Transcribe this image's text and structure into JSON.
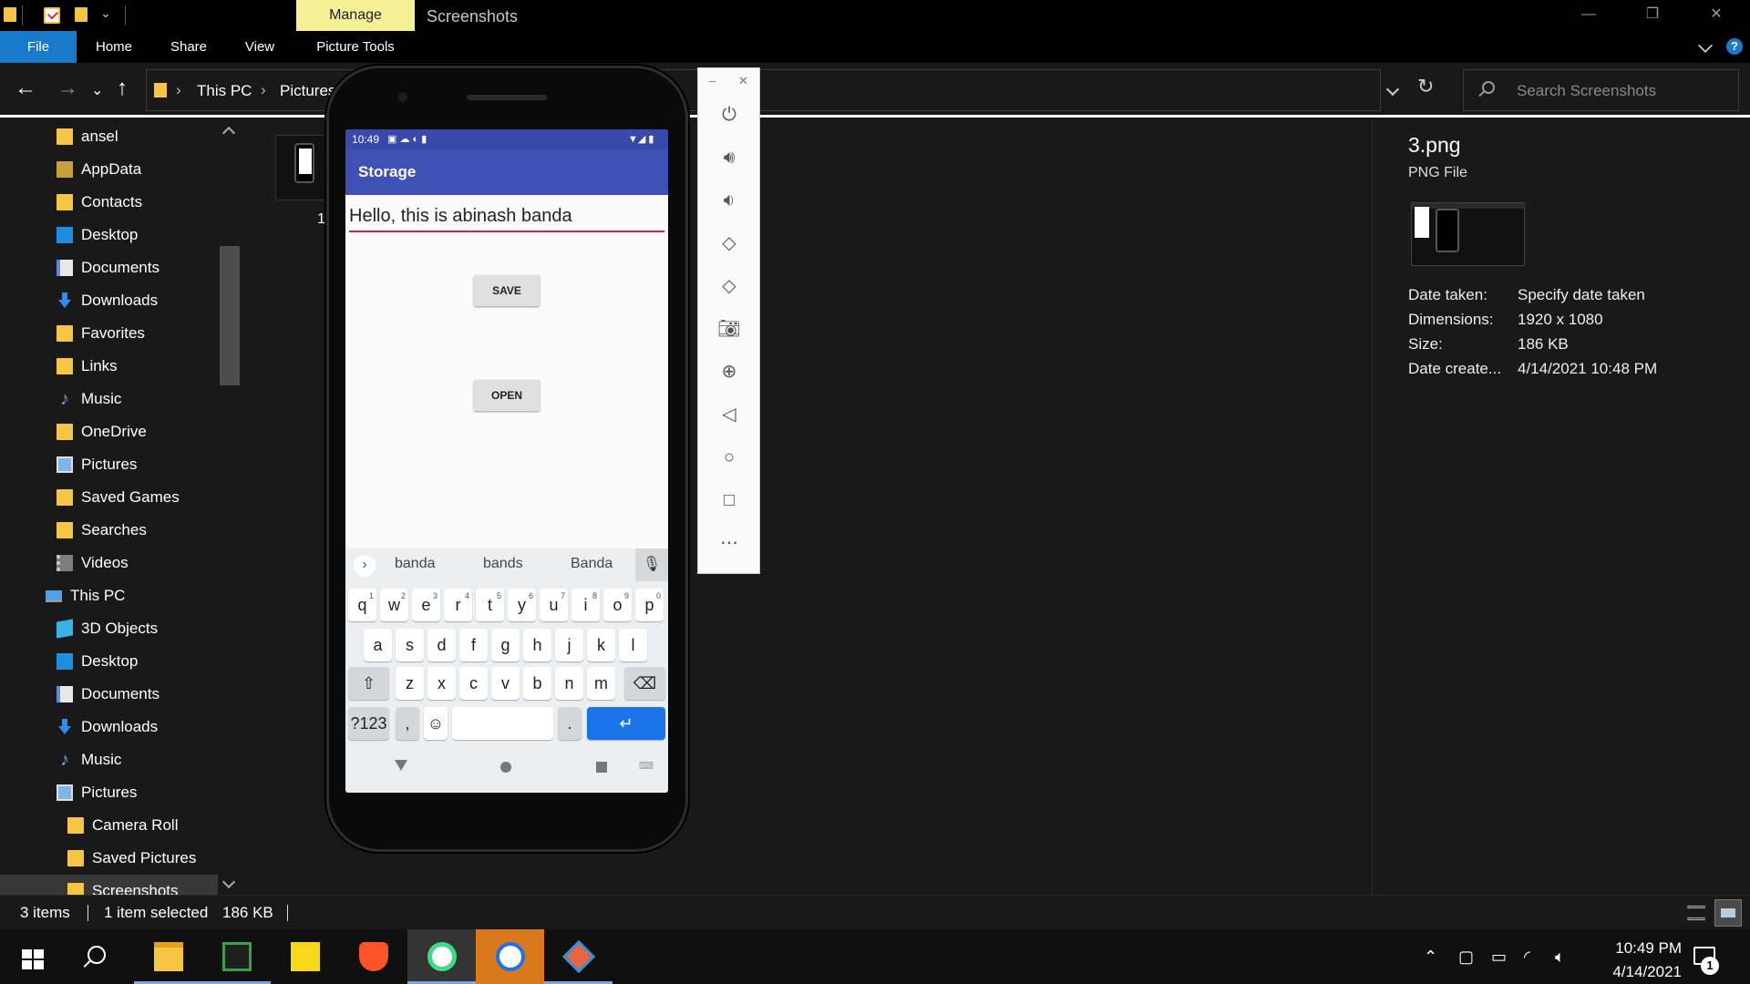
{
  "window": {
    "manage_tab": "Manage",
    "title": "Screenshots",
    "controls": {
      "minimize": "—",
      "maximize": "❐",
      "close": "✕"
    }
  },
  "ribbon": {
    "tabs": [
      "File",
      "Home",
      "Share",
      "View",
      "Picture Tools"
    ]
  },
  "addressbar": {
    "crumbs": [
      "This PC",
      "Pictures"
    ],
    "search_placeholder": "Search Screenshots"
  },
  "navpane": {
    "items": [
      {
        "label": "ansel",
        "icon": "folder-icon"
      },
      {
        "label": "AppData",
        "icon": "folder-icon"
      },
      {
        "label": "Contacts",
        "icon": "contacts-icon"
      },
      {
        "label": "Desktop",
        "icon": "desktop-icon"
      },
      {
        "label": "Documents",
        "icon": "documents-icon"
      },
      {
        "label": "Downloads",
        "icon": "downloads-icon"
      },
      {
        "label": "Favorites",
        "icon": "favorites-icon"
      },
      {
        "label": "Links",
        "icon": "links-icon"
      },
      {
        "label": "Music",
        "icon": "music-icon"
      },
      {
        "label": "OneDrive",
        "icon": "onedrive-icon"
      },
      {
        "label": "Pictures",
        "icon": "pictures-icon"
      },
      {
        "label": "Saved Games",
        "icon": "saved-games-icon"
      },
      {
        "label": "Searches",
        "icon": "searches-icon"
      },
      {
        "label": "Videos",
        "icon": "videos-icon"
      },
      {
        "label": "This PC",
        "icon": "this-pc-icon"
      },
      {
        "label": "3D Objects",
        "icon": "3d-objects-icon"
      },
      {
        "label": "Desktop",
        "icon": "desktop-icon"
      },
      {
        "label": "Documents",
        "icon": "documents-icon"
      },
      {
        "label": "Downloads",
        "icon": "downloads-icon"
      },
      {
        "label": "Music",
        "icon": "music-icon"
      },
      {
        "label": "Pictures",
        "icon": "pictures-icon"
      },
      {
        "label": "Camera Roll",
        "icon": "folder-icon"
      },
      {
        "label": "Saved Pictures",
        "icon": "folder-icon"
      },
      {
        "label": "Screenshots",
        "icon": "folder-icon",
        "selected": true
      }
    ]
  },
  "content": {
    "partial_label": "1"
  },
  "details": {
    "name": "3.png",
    "type": "PNG File",
    "rows": [
      {
        "key": "Date taken:",
        "value": "Specify date taken"
      },
      {
        "key": "Dimensions:",
        "value": "1920 x 1080"
      },
      {
        "key": "Size:",
        "value": "186 KB"
      },
      {
        "key": "Date create...",
        "value": "4/14/2021 10:48 PM"
      }
    ]
  },
  "statusbar": {
    "items_count": "3 items",
    "selected": "1 item selected",
    "size": "186 KB"
  },
  "emulator": {
    "status_time": "10:49",
    "app_title": "Storage",
    "edit_text": "Hello, this is abinash banda",
    "save_label": "SAVE",
    "open_label": "OPEN",
    "suggestions": [
      "banda",
      "bands",
      "Banda"
    ],
    "rows": [
      [
        "q",
        "w",
        "e",
        "r",
        "t",
        "y",
        "u",
        "i",
        "o",
        "p"
      ],
      [
        "a",
        "s",
        "d",
        "f",
        "g",
        "h",
        "j",
        "k",
        "l"
      ],
      [
        "z",
        "x",
        "c",
        "v",
        "b",
        "n",
        "m"
      ]
    ],
    "digits": [
      "1",
      "2",
      "3",
      "4",
      "5",
      "6",
      "7",
      "8",
      "9",
      "0"
    ],
    "symbols_key": "?123",
    "comma_key": ",",
    "period_key": "."
  },
  "taskbar": {
    "time": "10:49 PM",
    "date": "4/14/2021",
    "notifications": "1"
  },
  "colors": {
    "accent": "#1979ca",
    "manage_tab": "#f5f095",
    "android_appbar": "#3f51b5",
    "android_accent": "#d81b60"
  }
}
